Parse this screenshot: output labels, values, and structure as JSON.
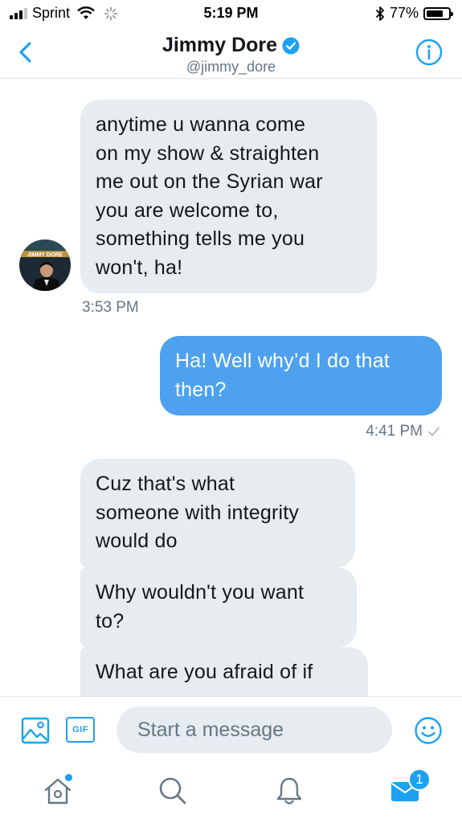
{
  "status_bar": {
    "carrier": "Sprint",
    "time": "5:19 PM",
    "battery_percent": "77%",
    "battery_level": 0.77,
    "signal_bars_filled": 3,
    "signal_bars_total": 4
  },
  "header": {
    "name": "Jimmy Dore",
    "handle": "@jimmy_dore",
    "verified": true
  },
  "conversation": {
    "messages": [
      {
        "direction": "in",
        "text": "anytime u wanna come on my show & straighten me out on the Syrian war you are welcome to, something tells me you won't, ha!",
        "lines": [
          "anytime u wanna come",
          "on my show & straighten",
          "me out on the Syrian war",
          "you are welcome to,",
          "something tells me you",
          "won't, ha!"
        ]
      },
      {
        "direction": "out",
        "text": "Ha! Well why’d I do that then?",
        "lines": [
          "Ha! Well why’d I do that",
          "then?"
        ]
      },
      {
        "direction": "in",
        "text": "Cuz that's what someone with integrity would do",
        "lines": [
          "Cuz that's what",
          "someone with integrity",
          "would do"
        ]
      },
      {
        "direction": "in",
        "text": "Why wouldn't you want to?",
        "lines": [
          "Why wouldn't you want",
          "to?"
        ]
      },
      {
        "direction": "in",
        "text": "What are you afraid of if",
        "lines": [
          "What are you afraid of if"
        ]
      }
    ],
    "timestamps": {
      "first": "3:53 PM",
      "second": "4:41 PM"
    },
    "avatar_text": "JIMMY DORE"
  },
  "composer": {
    "placeholder": "Start a message",
    "gif_label": "GIF"
  },
  "tab_bar": {
    "messages_badge": "1"
  },
  "colors": {
    "accent": "#1da1f2",
    "outgoing_bubble": "#4da1ee",
    "incoming_bubble": "#e6ecf0",
    "secondary_text": "#657786"
  },
  "icons": [
    "back-chevron-icon",
    "verified-badge-icon",
    "info-icon",
    "image-icon",
    "gif-icon",
    "smiley-icon",
    "home-icon",
    "search-icon",
    "bell-icon",
    "mail-icon",
    "checkmark-icon"
  ]
}
